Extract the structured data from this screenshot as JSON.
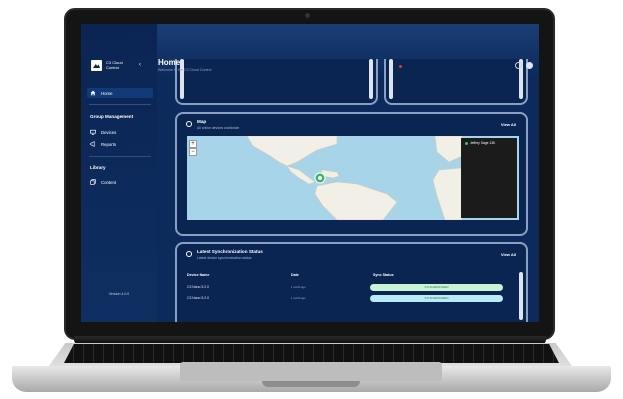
{
  "app": {
    "brand_name": "C3 Cloud Control",
    "version": "Version 4.0.0"
  },
  "sidebar": {
    "items": [
      {
        "label": "Home",
        "icon": "home-icon",
        "active": true
      },
      {
        "label": "Devices",
        "icon": "monitor-icon",
        "active": false
      },
      {
        "label": "Reports",
        "icon": "megaphone-icon",
        "active": false
      },
      {
        "label": "Content",
        "icon": "copy-icon",
        "active": false
      }
    ],
    "sections": {
      "group_management": "Group Management",
      "library": "Library"
    }
  },
  "header": {
    "title": "Home",
    "subtitle": "Welcome to the C3 Cloud Control"
  },
  "map_card": {
    "title": "Map",
    "subtitle": "All online devices worldwide",
    "view_all": "View All",
    "zoom_in": "+",
    "zoom_out": "−",
    "legend_item": "Jeffrey Sage 136"
  },
  "sync_card": {
    "title": "Latest Synchronization Status",
    "subtitle": "Latest device synchronization status",
    "view_all": "View All",
    "columns": [
      "Device Name",
      "Date",
      "Sync Status"
    ],
    "rows": [
      {
        "device": "C3 Nano 5.2.0",
        "date": "1 month ago",
        "status": "SYNCHRONIZED"
      },
      {
        "device": "C3 Nano 5.2.0",
        "date": "1 month ago",
        "status": "SYNCHRONIZED"
      }
    ]
  },
  "colors": {
    "brand_navy": "#0b2453",
    "status_green": "#c9f3d3",
    "map_water": "#a7d4e8"
  }
}
